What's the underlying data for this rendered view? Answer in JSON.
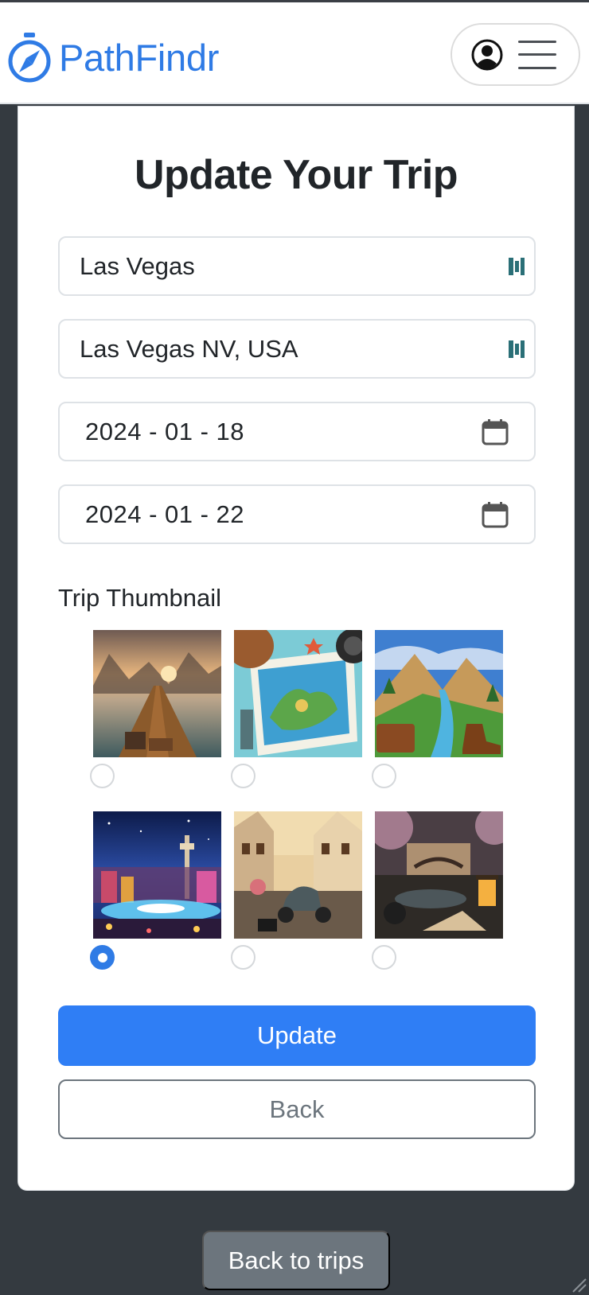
{
  "app": {
    "brand_name": "PathFindr",
    "brand_color": "#2f7be5"
  },
  "header": {
    "logo_icon": "compass-icon",
    "user_icon": "user-circle-icon",
    "menu_icon": "hamburger-icon"
  },
  "form": {
    "title": "Update Your Trip",
    "trip_name": {
      "value": "Las Vegas",
      "trailing_icon": "password-manager-icon"
    },
    "destination": {
      "value": "Las Vegas NV, USA",
      "trailing_icon": "password-manager-icon"
    },
    "start_date": {
      "value": "2024 - 01 - 18",
      "icon": "calendar-icon"
    },
    "end_date": {
      "value": "2024 - 01 - 22",
      "icon": "calendar-icon"
    },
    "thumbnail_label": "Trip Thumbnail",
    "thumbnails": [
      {
        "name": "pier-sunset",
        "selected": false
      },
      {
        "name": "travel-map-flatlay",
        "selected": false
      },
      {
        "name": "mountain-valley-luggage",
        "selected": false
      },
      {
        "name": "las-vegas-night",
        "selected": true
      },
      {
        "name": "european-street-scooter",
        "selected": false
      },
      {
        "name": "asian-garden-lantern",
        "selected": false
      }
    ],
    "update_label": "Update",
    "back_label": "Back"
  },
  "footer": {
    "back_to_trips_label": "Back to trips"
  },
  "colors": {
    "primary": "#2f7ef5",
    "secondary": "#6c757d",
    "page_bg": "#343a40"
  }
}
